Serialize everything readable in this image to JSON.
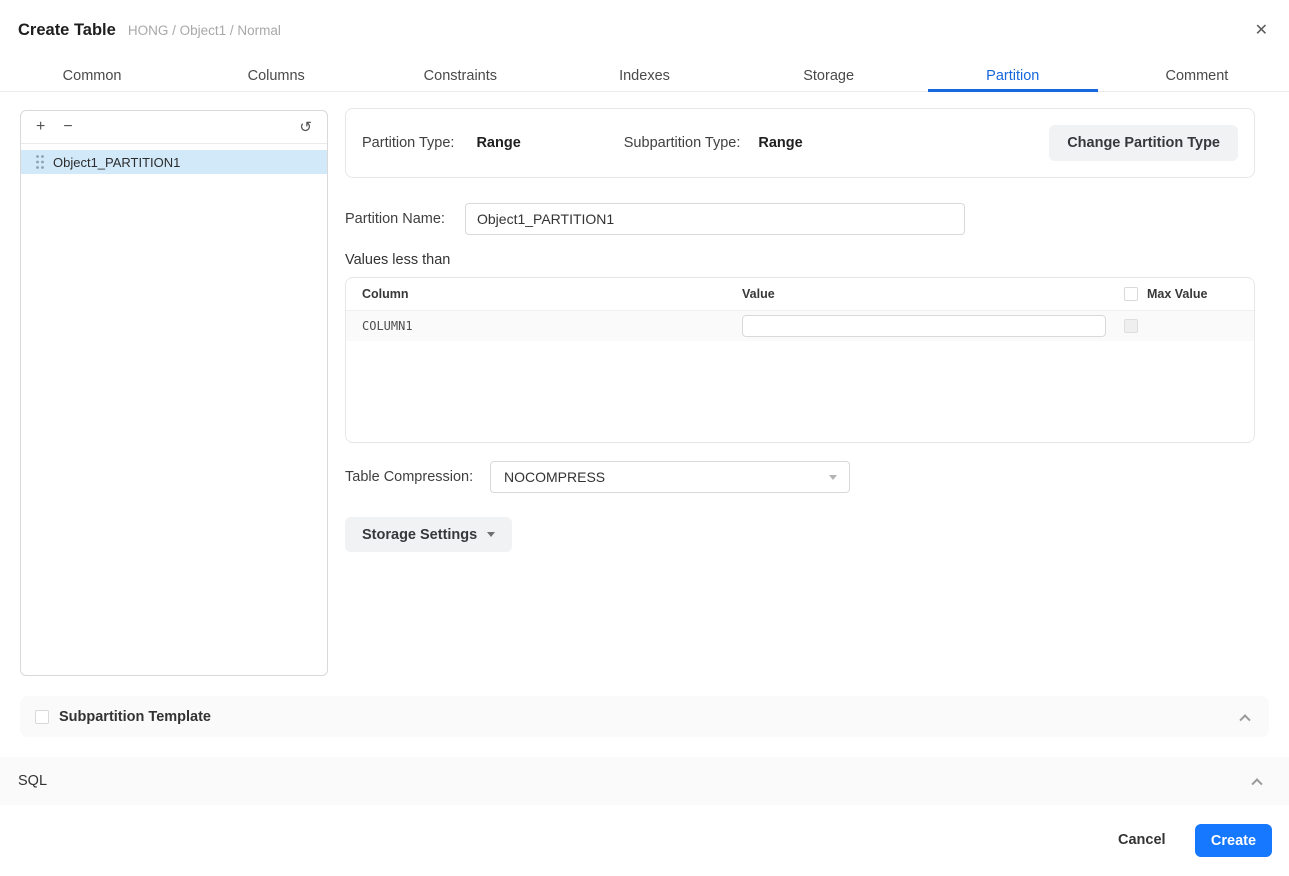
{
  "colors": {
    "primary_blue": "#1677ff",
    "tab_active_blue": "#1668dc",
    "selected_item_bg": "#d2e9fa",
    "section_bar_bg": "#fafafa",
    "secondary_button_bg": "#f1f2f4"
  },
  "header": {
    "title": "Create Table",
    "breadcrumb": "HONG / Object1 / Normal"
  },
  "icons": {
    "close": "✕",
    "plus": "+",
    "minus": "−",
    "refresh": "↺"
  },
  "tabs": {
    "items": [
      "Common",
      "Columns",
      "Constraints",
      "Indexes",
      "Storage",
      "Partition",
      "Comment"
    ],
    "active": "Partition"
  },
  "partition_list": {
    "items": [
      {
        "name": "Object1_PARTITION1",
        "selected": true
      }
    ]
  },
  "type_panel": {
    "partition_type_label": "Partition Type:",
    "partition_type_value": "Range",
    "subpartition_type_label": "Subpartition Type:",
    "subpartition_type_value": "Range",
    "change_button_label": "Change Partition Type"
  },
  "form": {
    "partition_name_label": "Partition Name:",
    "partition_name_value": "Object1_PARTITION1",
    "values_heading": "Values less than",
    "table_compression_label": "Table Compression:",
    "table_compression_value": "NOCOMPRESS",
    "storage_settings_label": "Storage Settings"
  },
  "values_table": {
    "headers": {
      "column": "Column",
      "value": "Value",
      "max_value": "Max Value"
    },
    "rows": [
      {
        "column": "COLUMN1",
        "value": "",
        "max_value_checked": false
      }
    ]
  },
  "sections": {
    "subpartition_template_label": "Subpartition Template",
    "subpartition_checked": false,
    "sql_label": "SQL"
  },
  "footer": {
    "cancel_label": "Cancel",
    "create_label": "Create"
  }
}
